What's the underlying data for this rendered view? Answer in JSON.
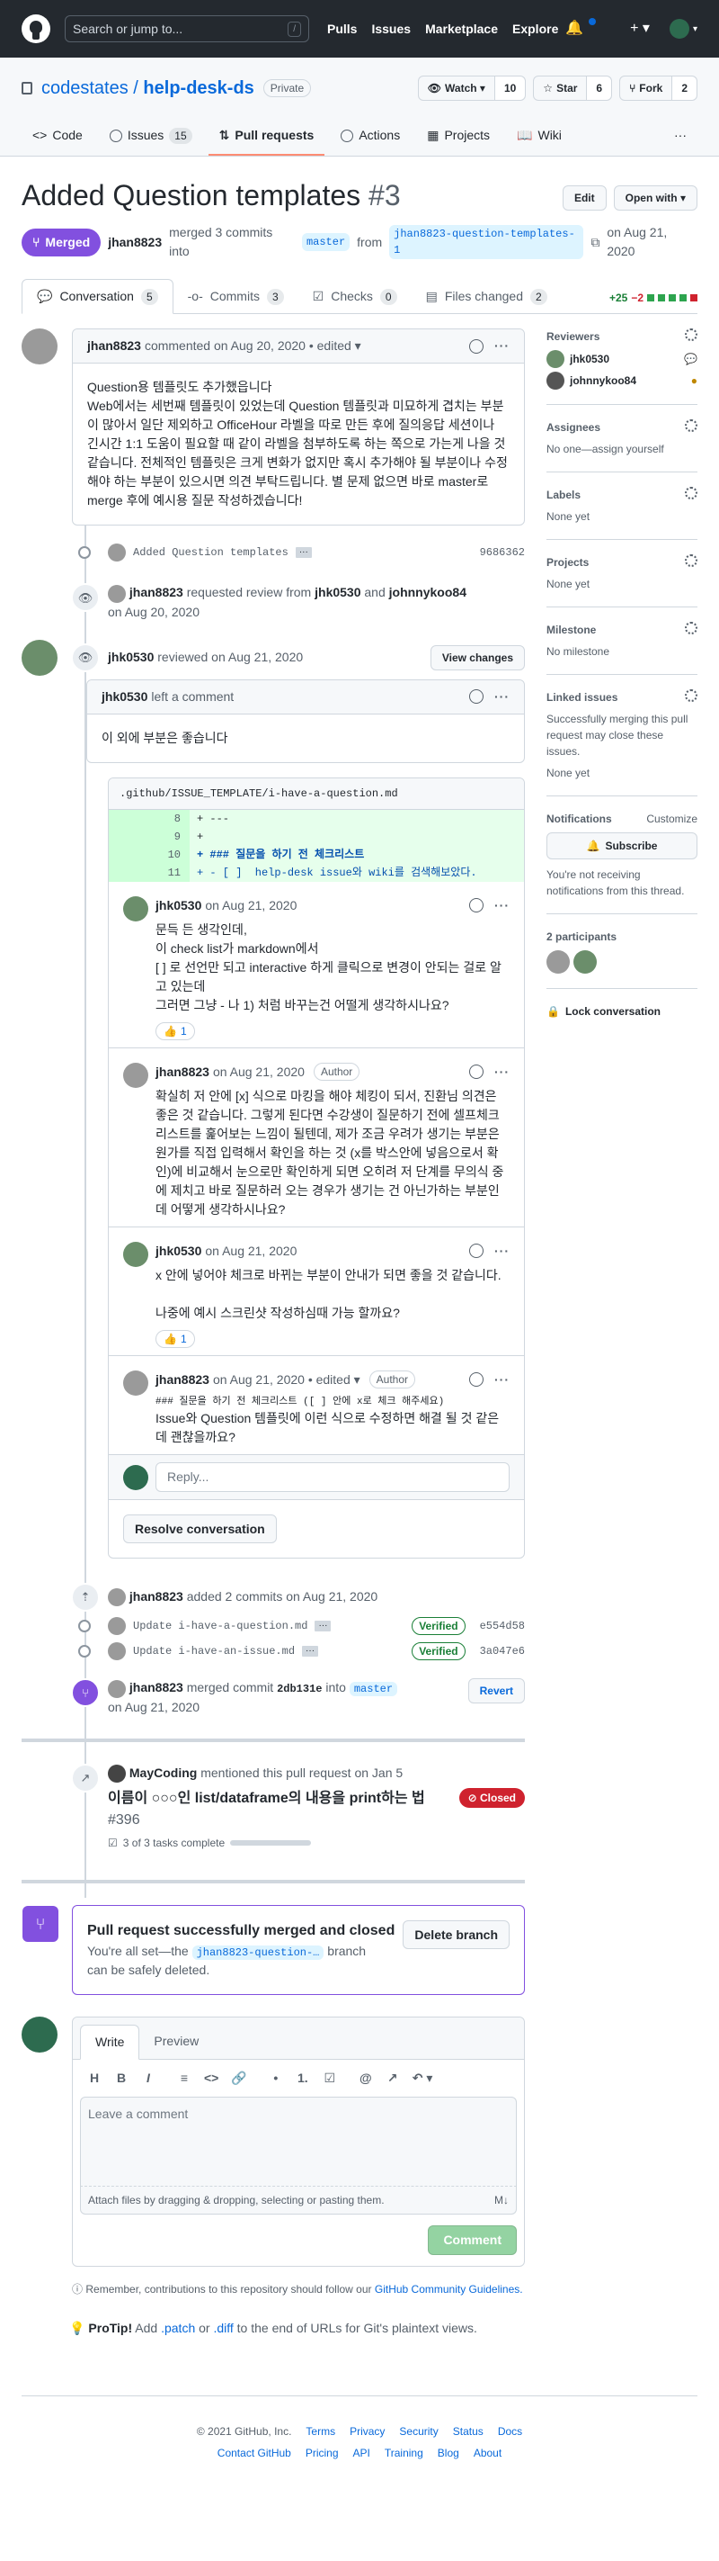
{
  "topbar": {
    "search_placeholder": "Search or jump to...",
    "slash": "/",
    "nav": [
      "Pulls",
      "Issues",
      "Marketplace",
      "Explore"
    ],
    "plus": "+ ▾",
    "avatar_caret": "▾"
  },
  "repo": {
    "owner": "codestates",
    "sep": "/",
    "name": "help-desk-ds",
    "visibility": "Private",
    "watch_label": "Watch ▾",
    "watch_count": "10",
    "star_label": "Star",
    "star_count": "6",
    "fork_label": "Fork",
    "fork_count": "2",
    "tabs": [
      {
        "label": "Code",
        "count": ""
      },
      {
        "label": "Issues",
        "count": "15"
      },
      {
        "label": "Pull requests",
        "count": ""
      },
      {
        "label": "Actions",
        "count": ""
      },
      {
        "label": "Projects",
        "count": ""
      },
      {
        "label": "Wiki",
        "count": ""
      }
    ],
    "more": "···"
  },
  "pr": {
    "title": "Added Question templates",
    "number": "#3",
    "edit_label": "Edit",
    "open_with_label": "Open with ▾",
    "state": "Merged",
    "author": "jhan8823",
    "merged_text": "merged 3 commits into",
    "base_branch": "master",
    "from_text": "from",
    "head_branch": "jhan8823-question-templates-1",
    "date_text": "on Aug 21, 2020",
    "tabs": [
      {
        "label": "Conversation",
        "count": "5"
      },
      {
        "label": "Commits",
        "count": "3"
      },
      {
        "label": "Checks",
        "count": "0"
      },
      {
        "label": "Files changed",
        "count": "2"
      }
    ],
    "additions": "+25",
    "deletions": "−2",
    "colors": {
      "merged": "#8250df",
      "added": "#1a7f37",
      "deleted": "#cf222e",
      "closed": "#cf222e",
      "verified": "#1a7f37"
    }
  },
  "timeline": {
    "first_comment": {
      "author": "jhan8823",
      "meta": "commented on Aug 20, 2020 • edited ▾",
      "body_1": "Question용 템플릿도 추가했읍니다",
      "body_2": "Web에서는 세번째 템플릿이 있었는데 Question 템플릿과 미묘하게 겹치는 부분이 많아서 일단 제외하고 OfficeHour 라벨을 따로 만든 후에 질의응답 세션이나 긴시간 1:1 도움이 필요할 때 같이 라벨을 첨부하도록 하는 쪽으로 가는게 나을 것 같습니다. 전체적인 템플릿은 크게 변화가 없지만 혹시 추가해야 될 부분이나 수정해야 하는 부분이 있으시면 의견 부탁드립니다. 별 문제 없으면 바로 master로 merge 후에 예시용 질문 작성하겠습니다!"
    },
    "commit1": {
      "message": "Added Question templates",
      "ellipsis": "···",
      "sha": "9686362"
    },
    "review_request": {
      "author": "jhk0530",
      "actor": "jhan8823",
      "text": "requested review from",
      "r1": "jhk0530",
      "and": "and",
      "r2": "johnnykoo84",
      "date": "on Aug 20, 2020"
    },
    "review": {
      "author": "jhk0530",
      "text": "reviewed on Aug 21, 2020",
      "button": "View changes"
    },
    "review_comment": {
      "author": "jhk0530",
      "meta": "left a comment",
      "body": "이 외에 부분은 좋습니다"
    },
    "file": {
      "path": ".github/ISSUE_TEMPLATE/i-have-a-question.md",
      "lines": [
        {
          "num": "8",
          "code": "+ ---"
        },
        {
          "num": "9",
          "code": "+"
        },
        {
          "num": "10",
          "code": "+ ### 질문을 하기 전 체크리스트"
        },
        {
          "num": "11",
          "code": "+ - [ ]  help-desk issue와 wiki를 검색해보았다."
        }
      ]
    },
    "thread": [
      {
        "author": "jhk0530",
        "date": "on Aug 21, 2020",
        "badge": "",
        "lines": [
          "문득 든 생각인데,",
          "이 check list가 markdown에서",
          "[ ] 로 선언만 되고 interactive 하게 클릭으로 변경이 안되는 걸로 알고 있는데",
          "그러면 그냥 - 나 1) 처럼 바꾸는건 어떨게 생각하시나요?"
        ],
        "reaction": "👍",
        "reaction_count": "1"
      },
      {
        "author": "jhan8823",
        "date": "on Aug 21, 2020",
        "badge": "Author",
        "lines": [
          "확실히 저 안에 [x] 식으로 마킹을 해야 체킹이 되서, 진환님 의견은 좋은 것 같습니다. 그렇게 된다면 수강생이 질문하기 전에 셀프체크리스트를 훑어보는 느낌이 될텐데, 제가 조금 우려가 생기는 부분은 원가를 직접 입력해서 확인을 하는 것 (x를 박스안에 넣음으로서 확인)에 비교해서 눈으로만 확인하게 되면 오히려 저 단계를 무의식 중에 제치고 바로 질문하러 오는 경우가 생기는 건 아닌가하는 부분인데 어떻게 생각하시나요?"
        ],
        "reaction": "",
        "reaction_count": ""
      },
      {
        "author": "jhk0530",
        "date": "on Aug 21, 2020",
        "badge": "",
        "lines": [
          "x 안에 넣어야 체크로 바뀌는 부분이 안내가 되면 좋을 것 같습니다.",
          "",
          "나중에 예시 스크린샷 작성하심때 가능 할까요?"
        ],
        "reaction": "👍",
        "reaction_count": "1"
      },
      {
        "author": "jhan8823",
        "date": "on Aug 21, 2020 • edited ▾",
        "badge": "Author",
        "lines": [
          "### 질문을 하기 전 체크리스트 ([ ] 안에 x로 체크 해주세요)",
          "Issue와 Question 템플릿에 이런 식으로 수정하면 해결 될 것 같은데 괜찮을까요?"
        ],
        "reaction": "",
        "reaction_count": ""
      }
    ],
    "reply_placeholder": "Reply...",
    "resolve_label": "Resolve conversation",
    "added_commits": {
      "actor": "jhan8823",
      "text": "added 2 commits on Aug 21, 2020"
    },
    "commits": [
      {
        "message": "Update i-have-a-question.md",
        "ellipsis": "···",
        "verified": "Verified",
        "sha": "e554d58"
      },
      {
        "message": "Update i-have-an-issue.md",
        "ellipsis": "···",
        "verified": "Verified",
        "sha": "3a047e6"
      }
    ],
    "merge_event": {
      "actor": "jhan8823",
      "text": "merged commit",
      "sha": "2db131e",
      "into": "into",
      "branch": "master",
      "date": "on Aug 21, 2020",
      "revert": "Revert"
    },
    "mention": {
      "actor": "MayCoding",
      "text": "mentioned this pull request on Jan 5",
      "title": "이름이 ○○○인 list/dataframe의 내용을 print하는 법",
      "num": "#396",
      "state": "Closed",
      "tasks": "3 of 3 tasks complete"
    }
  },
  "merge_box": {
    "title": "Pull request successfully merged and closed",
    "text_1": "You're all set—the",
    "branch": "jhan8823-question-…",
    "text_2": "branch",
    "text_3": "can be safely deleted.",
    "button": "Delete branch"
  },
  "composer": {
    "tab_write": "Write",
    "tab_preview": "Preview",
    "toolbar": [
      "H",
      "B",
      "I",
      "≡",
      "<>",
      "🔗",
      "•",
      "1.",
      "☑",
      "@",
      "↗",
      "↶ ▾"
    ],
    "placeholder": "Leave a comment",
    "attach": "Attach files by dragging & dropping, selecting or pasting them.",
    "md": "M↓",
    "submit": "Comment"
  },
  "notes": {
    "remember": "Remember, contributions to this repository should follow our",
    "guidelines": "GitHub Community Guidelines.",
    "protip_label": "ProTip!",
    "protip_1": "Add",
    "patch": ".patch",
    "or": "or",
    "diff": ".diff",
    "protip_2": "to the end of URLs for Git's plaintext views."
  },
  "sidebar": {
    "reviewers_title": "Reviewers",
    "reviewers": [
      {
        "name": "jhk0530",
        "status": "💬"
      },
      {
        "name": "johnnykoo84",
        "status": "●"
      }
    ],
    "assignees_title": "Assignees",
    "assignees_val": "No one—assign yourself",
    "labels_title": "Labels",
    "labels_val": "None yet",
    "projects_title": "Projects",
    "projects_val": "None yet",
    "milestone_title": "Milestone",
    "milestone_val": "No milestone",
    "linked_title": "Linked issues",
    "linked_desc": "Successfully merging this pull request may close these issues.",
    "linked_val": "None yet",
    "notifications_title": "Notifications",
    "customize": "Customize",
    "subscribe": "Subscribe",
    "notif_desc": "You're not receiving notifications from this thread.",
    "participants_title": "2 participants",
    "lock": "Lock conversation"
  },
  "footer": {
    "copyright": "© 2021 GitHub, Inc.",
    "row1": [
      "Terms",
      "Privacy",
      "Security",
      "Status",
      "Docs"
    ],
    "row2": [
      "Contact GitHub",
      "Pricing",
      "API",
      "Training",
      "Blog",
      "About"
    ]
  }
}
